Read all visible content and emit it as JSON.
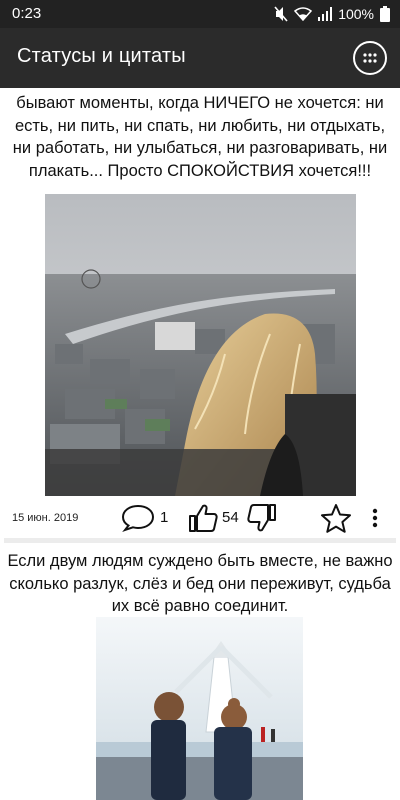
{
  "status_bar": {
    "time": "0:23",
    "battery": "100%",
    "icons": [
      "mute-icon",
      "wifi-icon",
      "signal-icon",
      "battery-icon"
    ]
  },
  "app_bar": {
    "title": "Статусы и цитаты",
    "menu_icon": "grid-menu-icon"
  },
  "posts": [
    {
      "text": "бывают моменты, когда НИЧЕГО не хочется: ни есть, ни пить, ни спать, ни любить, ни отдыхать, ни работать, ни улыбаться, ни разговаривать, ни плакать... Просто СПОКОЙСТВИЯ хочется!!!",
      "image": "photo-girl-london-view",
      "date": "15 июн. 2019",
      "comments": "1",
      "likes": "54"
    },
    {
      "text": "Если двум людям суждено быть вместе, не важно сколько разлук, слёз и бед они переживут, судьба их всё равно соединит.",
      "image": "photo-children-lighthouse"
    }
  ],
  "colors": {
    "status_bar": "#222222",
    "app_bar": "#2b2b2b",
    "divider": "#ececec"
  }
}
